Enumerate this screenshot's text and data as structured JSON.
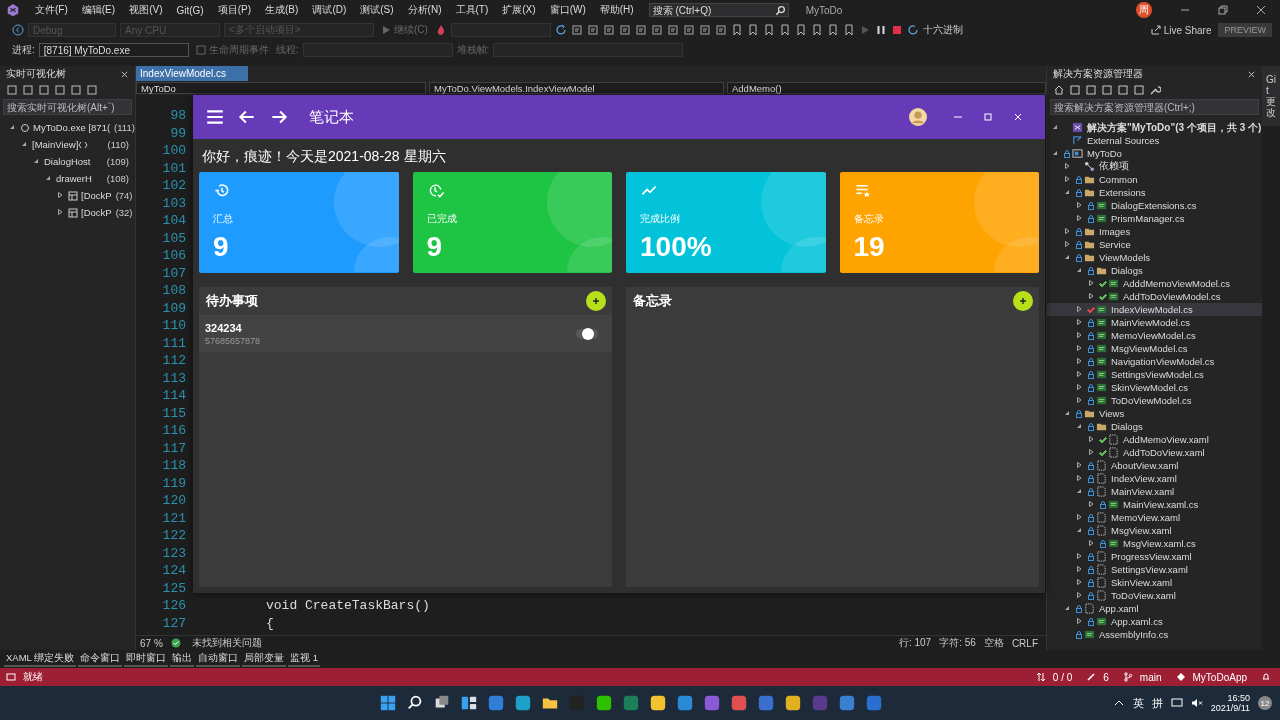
{
  "title_bar": {
    "menus": [
      "文件(F)",
      "编辑(E)",
      "视图(V)",
      "Git(G)",
      "项目(P)",
      "生成(B)",
      "调试(D)",
      "测试(S)",
      "分析(N)",
      "工具(T)",
      "扩展(X)",
      "窗口(W)",
      "帮助(H)"
    ],
    "search": {
      "placeholder": "搜索 (Ctrl+Q)"
    },
    "title": "MyToDo",
    "account_initial": "周"
  },
  "toolbar": {
    "configuration": "Debug",
    "platform": "Any CPU",
    "startup": "<多个启动项目>",
    "continue": "继续(C)",
    "hex": "十六进制",
    "live_share": "Live Share",
    "preview": "PREVIEW"
  },
  "debug_bar": {
    "process_label": "进程:",
    "process": "[8716] MyToDo.exe",
    "lifecycle": "生命周期事件",
    "thread_label": "线程:",
    "stack_label": "堆栈帧:"
  },
  "live_tree": {
    "title": "实时可视化树",
    "search": {
      "placeholder": "搜索实时可视化树(Alt+`)"
    },
    "tree": [
      {
        "label": "MyToDo.exe [871(",
        "count": "(111)",
        "kind": "process",
        "expanded": true,
        "children": [
          {
            "label": "[MainView]",
            "count": "(110)",
            "kind": "view",
            "expanded": true,
            "children": [
              {
                "label": "DialogHost",
                "count": "(109)",
                "expanded": true,
                "children": [
                  {
                    "label": "drawerH",
                    "count": "(108)",
                    "expanded": true,
                    "children": [
                      {
                        "label": "[DockP",
                        "count": "(74)",
                        "kind": "panel",
                        "expanded": false
                      },
                      {
                        "label": "[DockP",
                        "count": "(32)",
                        "kind": "panel",
                        "expanded": false
                      }
                    ]
                  }
                ]
              }
            ]
          }
        ]
      }
    ]
  },
  "editor": {
    "tab": "IndexViewModel.cs",
    "nav": [
      "MyToDo",
      "MyToDo.ViewModels.IndexViewModel",
      "AddMemo()"
    ],
    "lines": [
      {
        "number": "98"
      },
      {
        "number": "99"
      },
      {
        "number": "100"
      },
      {
        "number": "101"
      },
      {
        "number": "102"
      },
      {
        "number": "103"
      },
      {
        "number": "104"
      },
      {
        "number": "105"
      },
      {
        "number": "106"
      },
      {
        "number": "107"
      },
      {
        "number": "108"
      },
      {
        "number": "109"
      },
      {
        "number": "110"
      },
      {
        "number": "111"
      },
      {
        "number": "112"
      },
      {
        "number": "113"
      },
      {
        "number": "114"
      },
      {
        "number": "115"
      },
      {
        "number": "116"
      },
      {
        "number": "117"
      },
      {
        "number": "118"
      },
      {
        "number": "119"
      },
      {
        "number": "120"
      },
      {
        "number": "121"
      },
      {
        "number": "122"
      },
      {
        "number": "123"
      },
      {
        "number": "124"
      },
      {
        "number": "125"
      },
      {
        "number": "126",
        "code": "void CreateTaskBars()"
      },
      {
        "number": "127",
        "code": "{"
      }
    ],
    "status": {
      "zoom": "67 %",
      "issues": "未找到相关问题",
      "line": "行: 107",
      "char": "字符: 56",
      "spaces": "空格",
      "eol": "CRLF"
    }
  },
  "app_window": {
    "title": "笔记本",
    "greeting": "你好，痕迹！今天是2021-08-28 星期六",
    "cards": [
      {
        "kind": "total",
        "label": "汇总",
        "value": "9",
        "color": "#1e9bff"
      },
      {
        "kind": "done",
        "label": "已完成",
        "value": "9",
        "color": "#1ec443"
      },
      {
        "kind": "ratio",
        "label": "完成比例",
        "value": "100%",
        "color": "#02c3da"
      },
      {
        "kind": "memo",
        "label": "备忘录",
        "value": "19",
        "color": "#ffa300"
      }
    ],
    "todo": {
      "title": "待办事项",
      "items": [
        {
          "title": "324234",
          "content": "57685657878",
          "on": true
        }
      ]
    },
    "memo": {
      "title": "备忘录"
    }
  },
  "solution_explorer": {
    "title": "解决方案资源管理器",
    "search": {
      "placeholder": "搜索解决方案资源管理器(Ctrl+;)"
    },
    "tree": [
      {
        "label": "解决方案\"MyToDo\"(3 个项目，共 3 个)",
        "kind": "solution",
        "expanded": true,
        "children": [
          {
            "label": "External Sources",
            "kind": "external"
          },
          {
            "label": "MyToDo",
            "kind": "project",
            "checked_out": false,
            "expanded": true,
            "children": [
              {
                "label": "依赖项",
                "kind": "deps",
                "expanded": false
              },
              {
                "label": "Common",
                "kind": "folder",
                "checked_out": false,
                "expanded": false
              },
              {
                "label": "Extensions",
                "kind": "folder",
                "checked_out": false,
                "expanded": true,
                "children": [
                  {
                    "label": "DialogExtensions.cs",
                    "kind": "cs",
                    "checked_out": false,
                    "expanded": false
                  },
                  {
                    "label": "PrismManager.cs",
                    "kind": "cs",
                    "checked_out": false,
                    "expanded": false
                  }
                ]
              },
              {
                "label": "Images",
                "kind": "folder",
                "checked_out": false,
                "expanded": false
              },
              {
                "label": "Service",
                "kind": "folder",
                "checked_out": false,
                "expanded": false
              },
              {
                "label": "ViewModels",
                "kind": "folder",
                "checked_out": false,
                "expanded": true,
                "children": [
                  {
                    "label": "Dialogs",
                    "kind": "folder",
                    "checked_out": false,
                    "expanded": true,
                    "children": [
                      {
                        "label": "AdddMemoViewModel.cs",
                        "kind": "cs",
                        "checked_out": true,
                        "color": "#5bb85b",
                        "expanded": false
                      },
                      {
                        "label": "AddToDoViewModel.cs",
                        "kind": "cs",
                        "checked_out": true,
                        "color": "#5bb85b",
                        "expanded": false
                      }
                    ]
                  },
                  {
                    "label": "IndexViewModel.cs",
                    "kind": "cs",
                    "checked_out": true,
                    "color": "#d04848",
                    "expanded": false,
                    "selected": true
                  },
                  {
                    "label": "MainViewModel.cs",
                    "kind": "cs",
                    "checked_out": false,
                    "expanded": false
                  },
                  {
                    "label": "MemoViewModel.cs",
                    "kind": "cs",
                    "checked_out": false,
                    "expanded": false
                  },
                  {
                    "label": "MsgViewModel.cs",
                    "kind": "cs",
                    "checked_out": false,
                    "expanded": false
                  },
                  {
                    "label": "NavigationViewModel.cs",
                    "kind": "cs",
                    "checked_out": false,
                    "expanded": false
                  },
                  {
                    "label": "SettingsViewModel.cs",
                    "kind": "cs",
                    "checked_out": false,
                    "expanded": false
                  },
                  {
                    "label": "SkinViewModel.cs",
                    "kind": "cs",
                    "checked_out": false,
                    "expanded": false
                  },
                  {
                    "label": "ToDoViewModel.cs",
                    "kind": "cs",
                    "checked_out": false,
                    "expanded": false
                  }
                ]
              },
              {
                "label": "Views",
                "kind": "folder",
                "checked_out": false,
                "expanded": true,
                "children": [
                  {
                    "label": "Dialogs",
                    "kind": "folder",
                    "checked_out": false,
                    "expanded": true,
                    "children": [
                      {
                        "label": "AddMemoView.xaml",
                        "kind": "xaml",
                        "checked_out": true,
                        "color": "#5bb85b",
                        "expanded": false
                      },
                      {
                        "label": "AddToDoView.xaml",
                        "kind": "xaml",
                        "checked_out": true,
                        "color": "#5bb85b",
                        "expanded": false
                      }
                    ]
                  },
                  {
                    "label": "AboutView.xaml",
                    "kind": "xaml",
                    "checked_out": false,
                    "expanded": false
                  },
                  {
                    "label": "IndexView.xaml",
                    "kind": "xaml",
                    "checked_out": false,
                    "expanded": false
                  },
                  {
                    "label": "MainView.xaml",
                    "kind": "xaml",
                    "checked_out": false,
                    "expanded": true,
                    "children": [
                      {
                        "label": "MainView.xaml.cs",
                        "kind": "cs",
                        "checked_out": false,
                        "expanded": false
                      }
                    ]
                  },
                  {
                    "label": "MemoView.xaml",
                    "kind": "xaml",
                    "checked_out": false,
                    "expanded": false
                  },
                  {
                    "label": "MsgView.xaml",
                    "kind": "xaml",
                    "checked_out": false,
                    "expanded": true,
                    "children": [
                      {
                        "label": "MsgView.xaml.cs",
                        "kind": "cs",
                        "checked_out": false,
                        "expanded": false
                      }
                    ]
                  },
                  {
                    "label": "ProgressView.xaml",
                    "kind": "xaml",
                    "checked_out": false,
                    "expanded": false
                  },
                  {
                    "label": "SettingsView.xaml",
                    "kind": "xaml",
                    "checked_out": false,
                    "expanded": false
                  },
                  {
                    "label": "SkinView.xaml",
                    "kind": "xaml",
                    "checked_out": false,
                    "expanded": false
                  },
                  {
                    "label": "ToDoView.xaml",
                    "kind": "xaml",
                    "checked_out": false,
                    "expanded": false
                  }
                ]
              },
              {
                "label": "App.xaml",
                "kind": "xaml",
                "checked_out": false,
                "expanded": true,
                "children": [
                  {
                    "label": "App.xaml.cs",
                    "kind": "cs",
                    "checked_out": false,
                    "expanded": false
                  }
                ]
              },
              {
                "label": "AssemblyInfo.cs",
                "kind": "cs",
                "checked_out": false
              }
            ]
          }
        ]
      }
    ]
  },
  "side_tab": "Git 更改",
  "bottom_tabs": [
    "XAML 绑定失败",
    "命令窗口",
    "即时窗口",
    "输出",
    "自动窗口",
    "局部变量",
    "监视 1"
  ],
  "status_bar": {
    "state": "就绪",
    "errors": "0 / 0",
    "edits": "6",
    "branch": "main",
    "repo": "MyToDoApp"
  },
  "taskbar": {
    "ime_language": "英",
    "ime_mode": "拼",
    "time": "16:50",
    "date": "2021/9/11",
    "notifications": "12"
  }
}
